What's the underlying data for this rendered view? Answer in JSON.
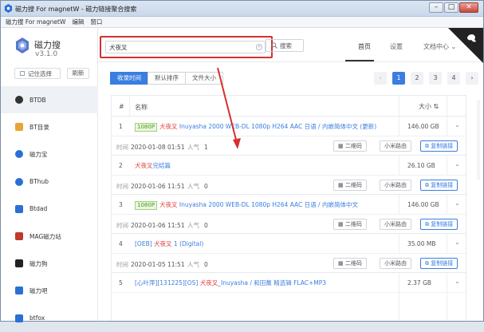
{
  "window": {
    "title": "磁力搜 For magnetW - 磁力链接聚合搜索",
    "buttons": {
      "minimize": "–",
      "maximize": "□",
      "close": "✕"
    }
  },
  "menubar": [
    "磁力搜 For magnetW",
    "编辑",
    "窗口"
  ],
  "brand": {
    "name": "磁力搜",
    "version": "v3.1.0"
  },
  "sidebar": {
    "remember_label": "记住选择",
    "refresh_label": "刷新",
    "engines": [
      {
        "label": "BTDB",
        "icon": "btdb-icon",
        "color": "#333333"
      },
      {
        "label": "BT目录",
        "icon": "bt-catalog-icon",
        "color": "#e8a435"
      },
      {
        "label": "磁力宝",
        "icon": "c-logo-icon",
        "color": "#2b6fd6"
      },
      {
        "label": "BThub",
        "icon": "bthub-icon",
        "color": "#2b6fd6"
      },
      {
        "label": "Btdad",
        "icon": "btdad-icon",
        "color": "#2b6fd6"
      },
      {
        "label": "MAG磁力站",
        "icon": "magnet-icon",
        "color": "#c0392b"
      },
      {
        "label": "磁力狗",
        "icon": "paw-icon",
        "color": "#222222"
      },
      {
        "label": "磁力吧",
        "icon": "dots-icon",
        "color": "#2b6fd6"
      },
      {
        "label": "btfox",
        "icon": "fox-icon",
        "color": "#2b6fd6"
      }
    ]
  },
  "search": {
    "value": "犬夜叉",
    "button_label": "搜索"
  },
  "nav": {
    "home": "首页",
    "settings": "设置",
    "docs": "文档中心"
  },
  "sort": {
    "options": [
      "收录时间",
      "默认排序",
      "文件大小"
    ],
    "active_index": 0
  },
  "pager": {
    "pages": [
      "1",
      "2",
      "3",
      "4"
    ],
    "active": "1",
    "prev": "‹",
    "next": "›"
  },
  "table": {
    "col_index": "#",
    "col_name": "名称",
    "col_size": "大小",
    "meta_time_label": "时间",
    "meta_hot_label": "人气",
    "btn_qr": "二维码",
    "btn_router": "小米路由",
    "btn_copy": "复制链接",
    "rows": [
      {
        "index": "1",
        "tag": "1080P",
        "hl": "犬夜叉",
        "rest": " Inuyasha 2000 WEB-DL 1080p H264 AAC 日语 / 内嵌简体中文 (更新)",
        "size": "146.00 GB",
        "time": "2020-01-08 01:51",
        "hot": "1"
      },
      {
        "index": "2",
        "tag": "",
        "hl": "犬夜叉",
        "rest": "完结篇",
        "size": "26.10 GB",
        "time": "2020-01-06 11:51",
        "hot": "0"
      },
      {
        "index": "3",
        "tag": "1080P",
        "hl": "犬夜叉",
        "rest": " Inuyasha 2000 WEB-DL 1080p H264 AAC 日语 / 内嵌简体中文",
        "size": "146.00 GB",
        "time": "2020-01-06 11:51",
        "hot": "0"
      },
      {
        "index": "4",
        "tag": "",
        "pre": "[OEB] ",
        "hl": "犬夜叉",
        "rest": " 1 (Digital)",
        "size": "35.00 MB",
        "time": "2020-01-05 11:51",
        "hot": "0"
      },
      {
        "index": "5",
        "tag": "",
        "pre": "[心叶萍][131225][OS] ",
        "hl": "犬夜叉",
        "rest": "_Inuyasha / 和田薰 精选辑 FLAC+MP3",
        "size": "2.37 GB",
        "time": "",
        "hot": ""
      }
    ]
  },
  "colors": {
    "accent": "#3b7de0",
    "highlight": "#e03c3c",
    "annotation": "#d63030"
  }
}
